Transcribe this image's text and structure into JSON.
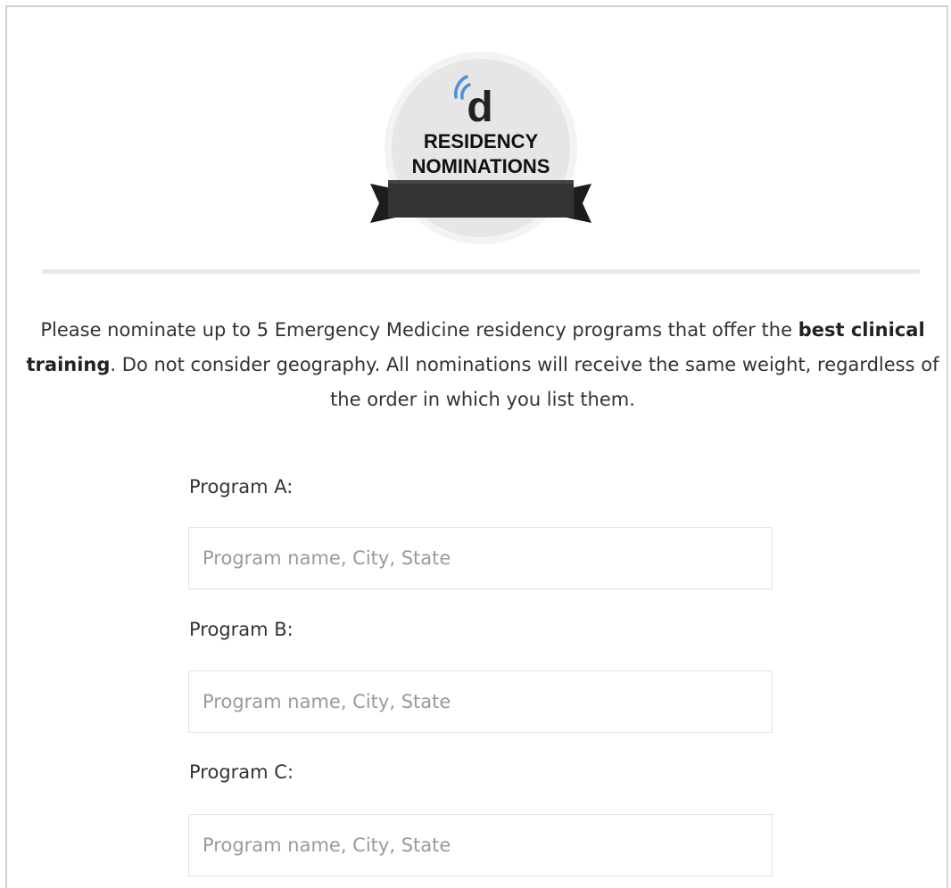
{
  "logo": {
    "letter": "d",
    "line1": "RESIDENCY",
    "line2": "NOMINATIONS",
    "icon": "broadcast-d-logo",
    "accent_color": "#4a90d9"
  },
  "intro": {
    "part1": "Please nominate up to 5 Emergency Medicine residency programs that offer the ",
    "bold": "best clinical training",
    "part2": ". Do not consider geography. All nominations will receive the same weight, regardless of the order in which you list them."
  },
  "programs": [
    {
      "label": "Program A:",
      "placeholder": "Program name, City, State",
      "value": ""
    },
    {
      "label": "Program B:",
      "placeholder": "Program name, City, State",
      "value": ""
    },
    {
      "label": "Program C:",
      "placeholder": "Program name, City, State",
      "value": ""
    }
  ]
}
